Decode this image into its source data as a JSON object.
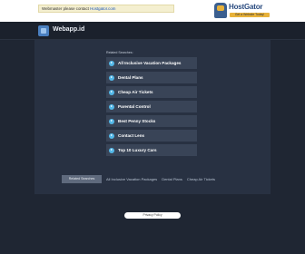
{
  "topbar": {
    "notice_text": "Webmaster please contact ",
    "notice_link": "Hostgator.com",
    "hostgator": {
      "name": "HostGator",
      "tagline": "Get a Website Today!"
    }
  },
  "header": {
    "site_title": "Webapp.id"
  },
  "related": {
    "label": "Related Searches:",
    "items": [
      {
        "label": "All Inclusive Vacation Packages"
      },
      {
        "label": "Dental Plans"
      },
      {
        "label": "Cheap Air Tickets"
      },
      {
        "label": "Parental Control"
      },
      {
        "label": "Best Penny Stocks"
      },
      {
        "label": "Contact Lens"
      },
      {
        "label": "Top 10 Luxury Cars"
      }
    ]
  },
  "bottom": {
    "search_button": "Related Searches",
    "links": [
      {
        "label": "All Inclusive Vacation Packages"
      },
      {
        "label": "Dental Plans"
      },
      {
        "label": "Cheap Air Tickets"
      }
    ]
  },
  "footer": {
    "privacy": "Privacy Policy"
  },
  "colors": {
    "background": "#1f2633",
    "panel": "#283142",
    "item": "#394457",
    "accent": "#54b8e8"
  }
}
